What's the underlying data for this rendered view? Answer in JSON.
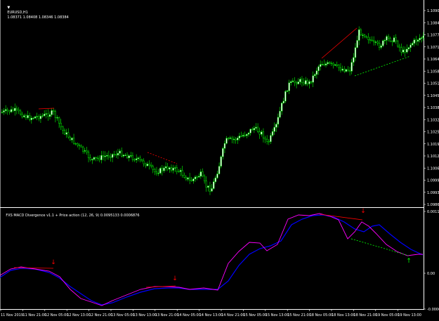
{
  "main_chart": {
    "symbol_label": "EURUSD,H1",
    "ohlc": "1.08371 1.08408 1.08346 1.08384",
    "price_labels": [
      "1.10905",
      "1.10840",
      "1.10775",
      "1.10710",
      "1.10640",
      "1.10580",
      "1.10515",
      "1.10450",
      "1.10385",
      "1.10320",
      "1.10255",
      "1.10190",
      "1.10125",
      "1.10060",
      "1.09995",
      "1.09930",
      "1.09865"
    ]
  },
  "indicator": {
    "title": "FXS MACD Divergence v1.1 + Price action (12, 26, 9) 0.0095133 0.0006876",
    "scale_labels": [
      "0.001100",
      "0.00",
      "-0.000660"
    ]
  },
  "time_axis": {
    "labels": [
      "11 Nov 2019",
      "11 Nov 21:00",
      "12 Nov 05:00",
      "12 Nov 13:00",
      "12 Nov 21:00",
      "13 Nov 05:00",
      "13 Nov 13:00",
      "13 Nov 21:00",
      "14 Nov 05:00",
      "14 Nov 13:00",
      "14 Nov 21:00",
      "15 Nov 05:00",
      "15 Nov 13:00",
      "15 Nov 21:00",
      "18 Nov 05:00",
      "18 Nov 13:00",
      "18 Nov 21:00",
      "19 Nov 05:00",
      "19 Nov 13:00"
    ]
  },
  "colors": {
    "background": "#000000",
    "bull_candle": "#ffffff",
    "bear_candle": "#000000",
    "candle_outline": "#00ff00",
    "macd_line": "#ff00ff",
    "signal_line": "#0000ff",
    "bear_divergence": "#ff0000",
    "bull_divergence": "#00ff00"
  },
  "markers": [
    {
      "type": "sell-arrow",
      "symbol": "↓",
      "color": "#ff0000"
    },
    {
      "type": "sell-arrow",
      "symbol": "↓",
      "color": "#ff0000"
    },
    {
      "type": "sell-arrow",
      "symbol": "↓",
      "color": "#ff0000"
    },
    {
      "type": "buy-arrow",
      "symbol": "↑",
      "color": "#00ff00"
    }
  ]
}
